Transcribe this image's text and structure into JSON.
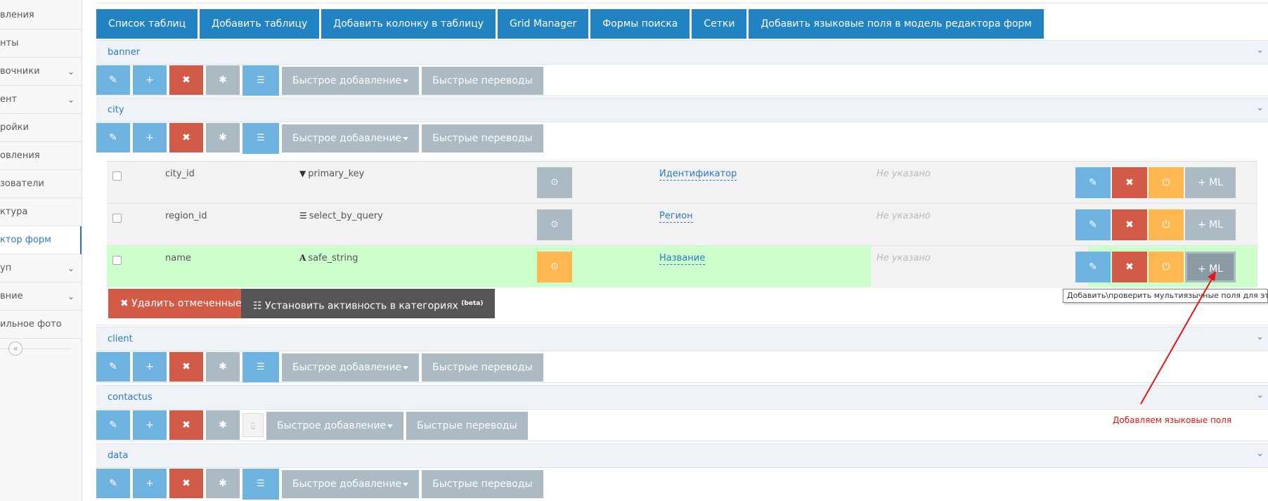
{
  "sidebar": {
    "items": [
      {
        "label": "вления",
        "chevron": false,
        "active": false
      },
      {
        "label": "нты",
        "chevron": false,
        "active": false
      },
      {
        "label": "вочники",
        "chevron": true,
        "active": false
      },
      {
        "label": "ент",
        "chevron": true,
        "active": false
      },
      {
        "label": "ройки",
        "chevron": false,
        "active": false
      },
      {
        "label": "овления",
        "chevron": false,
        "active": false
      },
      {
        "label": "зователи",
        "chevron": false,
        "active": false
      },
      {
        "label": "ктура",
        "chevron": false,
        "active": false
      },
      {
        "label": "ктор форм",
        "chevron": false,
        "active": true
      },
      {
        "label": "уп",
        "chevron": true,
        "active": false
      },
      {
        "label": "вние",
        "chevron": true,
        "active": false
      },
      {
        "label": "ильное фото",
        "chevron": false,
        "active": false
      }
    ],
    "collapse_glyph": "«"
  },
  "nav": {
    "buttons": [
      "Список таблиц",
      "Добавить таблицу",
      "Добавить колонку в таблицу",
      "Grid Manager",
      "Формы поиска",
      "Сетки",
      "Добавить языковые поля в модель редактора форм"
    ]
  },
  "toolbar": {
    "edit_glyph": "✎",
    "add_glyph": "+",
    "delete_glyph": "✖",
    "star_glyph": "✱",
    "list_glyph": "☰",
    "quick_add_label": "Быстрое добавление",
    "quick_translate_label": "Быстрые переводы"
  },
  "tables": [
    {
      "name": "banner"
    },
    {
      "name": "city"
    },
    {
      "name": "client"
    },
    {
      "name": "contactus"
    },
    {
      "name": "data"
    }
  ],
  "city_fields": [
    {
      "field": "city_id",
      "type_icon": "▼",
      "type": "primary_key",
      "label": "Идентификатор",
      "description": "Не указано",
      "highlight": false
    },
    {
      "field": "region_id",
      "type_icon": "☰",
      "type": "select_by_query",
      "label": "Регион",
      "description": "Не указано",
      "highlight": false
    },
    {
      "field": "name",
      "type_icon": "A",
      "type": "safe_string",
      "label": "Название",
      "description": "Не указано",
      "highlight": true
    }
  ],
  "row_actions": {
    "edit_glyph": "✎",
    "delete_glyph": "✖",
    "power_glyph": "⏻",
    "ml_label": "+ ML",
    "field_btn_glyph": "⊙"
  },
  "bulk": {
    "delete_label": "✖ Удалить отмеченные",
    "activity_label": "Установить активность в категориях",
    "activity_sup": "(beta)",
    "activity_glyph": "☷"
  },
  "tooltip": "Добавить\\проверить мультиязычные поля для этого",
  "annotation": "Добавляем языковые поля",
  "colors": {
    "primary": "#2283c3",
    "light_blue": "#6fb3e0",
    "red": "#d15b47",
    "gray": "#abbac3",
    "orange": "#ffb752",
    "highlight_row": "#ccffcc",
    "annotation": "#ee1111"
  }
}
